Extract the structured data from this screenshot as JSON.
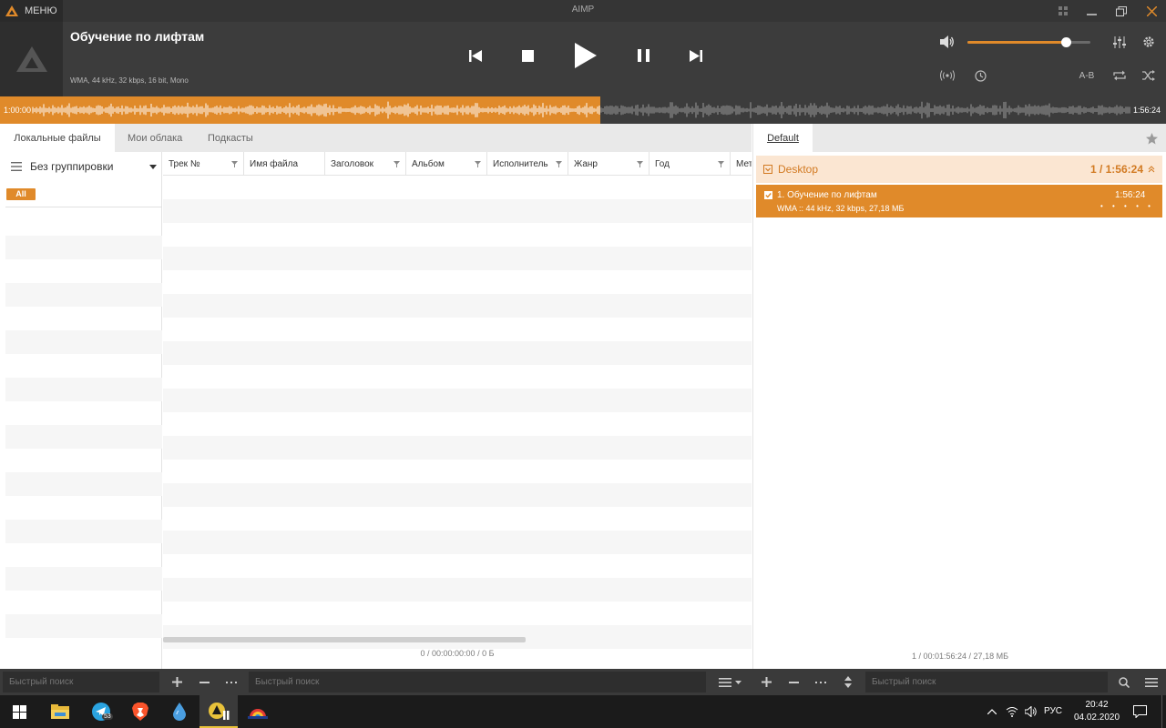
{
  "app": {
    "menu_label": "МЕНЮ",
    "title": "AIMP"
  },
  "player": {
    "track_title": "Обучение по лифтам",
    "track_info": "WMA, 44 kHz, 32 kbps, 16 bit, Mono",
    "volume_level": 0.8,
    "ab_label": "A-B",
    "progress_fraction": 0.515
  },
  "waveform": {
    "time_elapsed": "1:00:00",
    "time_total": "1:56:24"
  },
  "library": {
    "tabs": [
      {
        "label": "Локальные файлы",
        "active": true
      },
      {
        "label": "Мои облака",
        "active": false
      },
      {
        "label": "Подкасты",
        "active": false
      }
    ],
    "grouping_label": "Без группировки",
    "filter_all": "All",
    "columns": [
      "Трек №",
      "Имя файла",
      "Заголовок",
      "Альбом",
      "Исполнитель",
      "Жанр",
      "Год",
      "Мет"
    ],
    "status": "0 / 00:00:00:00 / 0 Б"
  },
  "playlist": {
    "tab_label": "Default",
    "group_name": "Desktop",
    "group_total": "1 / 1:56:24",
    "items": [
      {
        "title": "1. Обучение по лифтам",
        "info": "WMA :: 44 kHz, 32 kbps, 27,18 МБ",
        "duration": "1:56:24",
        "rating": "• • • • •"
      }
    ],
    "status": "1 / 00:01:56:24 / 27,18 МБ"
  },
  "bottom": {
    "search_placeholder": "Быстрый поиск"
  },
  "taskbar": {
    "telegram_badge": "53",
    "language": "РУС",
    "time": "20:42",
    "date": "04.02.2020"
  },
  "colors": {
    "accent": "#e08a2a",
    "dark_bg": "#3c3c3c",
    "taskbar_bg": "#1b1b1b"
  }
}
